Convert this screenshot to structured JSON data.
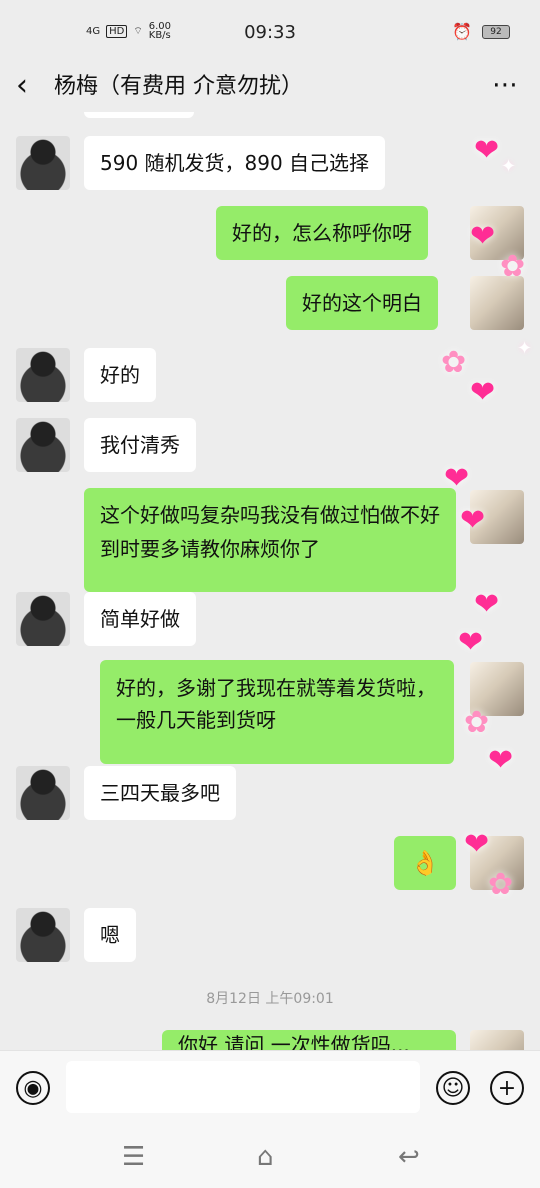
{
  "status": {
    "time": "09:33",
    "network": "4G",
    "hd": "HD",
    "speed_top": "6.00",
    "speed_bottom": "KB/s",
    "battery": "92"
  },
  "header": {
    "back_label": "‹",
    "title": "杨梅（有费用 介意勿扰）",
    "more_label": "⋯"
  },
  "messages": [
    {
      "side": "left",
      "text": "590 随机发货，890 自己选择"
    },
    {
      "side": "right",
      "text": "好的，怎么称呼你呀"
    },
    {
      "side": "right",
      "text": "好的这个明白"
    },
    {
      "side": "left",
      "text": "好的"
    },
    {
      "side": "left",
      "text": "我付清秀"
    },
    {
      "side": "right",
      "text": "这个好做吗复杂吗我没有做过怕做不好到时要多请教你麻烦你了"
    },
    {
      "side": "left",
      "text": "简单好做"
    },
    {
      "side": "right",
      "text": "好的，多谢了我现在就等着发货啦，一般几天能到货呀"
    },
    {
      "side": "left",
      "text": "三四天最多吧"
    },
    {
      "side": "right",
      "text": "👌"
    },
    {
      "side": "left",
      "text": "嗯"
    }
  ],
  "timestamp": "8月12日 上午09:01",
  "partial_message": "你好 请问 一次性做货吗...",
  "input": {
    "voice_icon": "voice-icon",
    "emoji_icon": "emoji-icon",
    "plus_icon": "plus-icon"
  },
  "nav": {
    "menu": "☰",
    "home": "⌂",
    "back": "↩"
  },
  "colors": {
    "background": "#ededed",
    "green_bubble": "#95ec69",
    "white_bubble": "#ffffff",
    "deco_pink": "#ff2d95"
  }
}
